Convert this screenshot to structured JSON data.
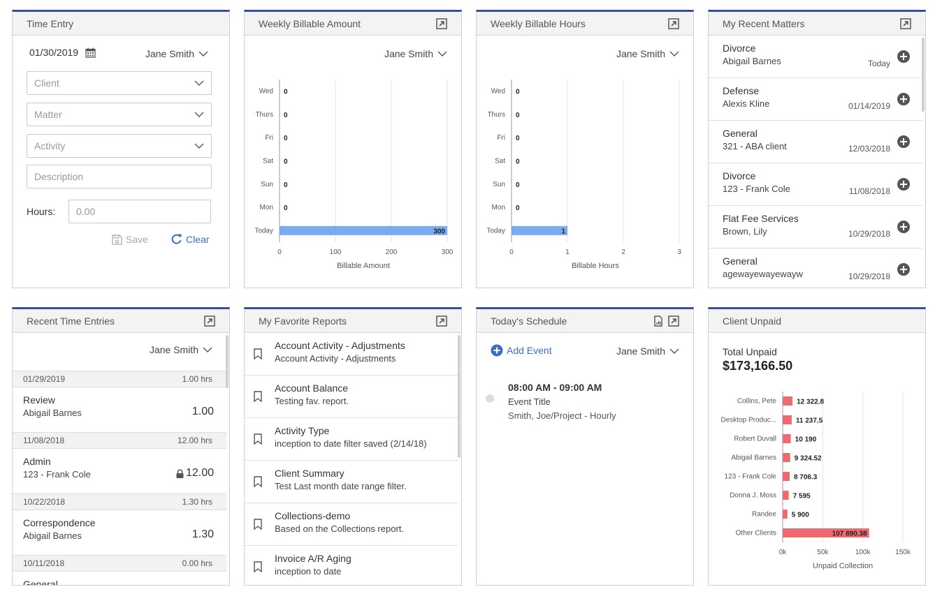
{
  "colors": {
    "accent": "#3a4f9e",
    "link": "#3a6fc7",
    "bar_blue": "#7aaaf0",
    "bar_red": "#ec6b72"
  },
  "time_entry": {
    "title": "Time Entry",
    "date": "01/30/2019",
    "user": "Jane Smith",
    "client_placeholder": "Client",
    "matter_placeholder": "Matter",
    "activity_placeholder": "Activity",
    "description_placeholder": "Description",
    "hours_label": "Hours:",
    "hours_placeholder": "0.00",
    "save_label": "Save",
    "clear_label": "Clear"
  },
  "billable_amount": {
    "title": "Weekly Billable Amount",
    "user": "Jane Smith"
  },
  "billable_hours": {
    "title": "Weekly Billable Hours",
    "user": "Jane Smith"
  },
  "recent_matters": {
    "title": "My Recent Matters",
    "items": [
      {
        "title": "Divorce",
        "sub": "Abigail Barnes",
        "date": "Today"
      },
      {
        "title": "Defense",
        "sub": "Alexis Kline",
        "date": "01/14/2019"
      },
      {
        "title": "General",
        "sub": "321 - ABA client",
        "date": "12/03/2018"
      },
      {
        "title": "Divorce",
        "sub": "123 - Frank Cole",
        "date": "11/08/2018"
      },
      {
        "title": "Flat Fee Services",
        "sub": "Brown, Lily",
        "date": "10/29/2018"
      },
      {
        "title": "General",
        "sub": "agewayewayewayw",
        "date": "10/29/2018"
      }
    ]
  },
  "recent_entries": {
    "title": "Recent Time Entries",
    "user": "Jane Smith",
    "groups": [
      {
        "date": "01/29/2019",
        "total": "1.00 hrs",
        "title": "Review",
        "sub": "Abigail Barnes",
        "hours": "1.00"
      },
      {
        "date": "11/08/2018",
        "total": "12.00 hrs",
        "title": "Admin",
        "sub": "123 - Frank Cole",
        "hours": "12.00"
      },
      {
        "date": "10/22/2018",
        "total": "1.30 hrs",
        "title": "Correspondence",
        "sub": "Abigail Barnes",
        "hours": "1.30"
      },
      {
        "date": "10/11/2018",
        "total": "0.00 hrs",
        "title": "General",
        "sub": "",
        "hours": ""
      }
    ]
  },
  "favorite_reports": {
    "title": "My Favorite Reports",
    "items": [
      {
        "title": "Account Activity - Adjustments",
        "sub": "Account Activity - Adjustments"
      },
      {
        "title": "Account Balance",
        "sub": "Testing fav. report."
      },
      {
        "title": "Activity Type",
        "sub": "inception to date filter saved (2/14/18)"
      },
      {
        "title": "Client Summary",
        "sub": "Test Last month date range filter."
      },
      {
        "title": "Collections-demo",
        "sub": "Based on the Collections report."
      },
      {
        "title": "Invoice A/R Aging",
        "sub": "inception to date"
      }
    ]
  },
  "schedule": {
    "title": "Today's Schedule",
    "add_event_label": "Add Event",
    "user": "Jane Smith",
    "event": {
      "time": "08:00 AM - 09:00 AM",
      "title": "Event Title",
      "sub": "Smith, Joe/Project - Hourly"
    }
  },
  "client_unpaid": {
    "title": "Client Unpaid",
    "total_label": "Total Unpaid",
    "total_value": "$173,166.50"
  },
  "chart_data": [
    {
      "type": "bar",
      "orientation": "horizontal",
      "categories": [
        "Wed",
        "Thurs",
        "Fri",
        "Sat",
        "Sun",
        "Mon",
        "Today"
      ],
      "values": [
        0,
        0,
        0,
        0,
        0,
        0,
        300
      ],
      "data_labels": [
        "0",
        "0",
        "0",
        "0",
        "0",
        "0",
        "300"
      ],
      "xlabel": "Billable Amount",
      "xticks": [
        "0",
        "100",
        "200",
        "300"
      ],
      "xlim": [
        0,
        300
      ],
      "grid": true
    },
    {
      "type": "bar",
      "orientation": "horizontal",
      "categories": [
        "Wed",
        "Thurs",
        "Fri",
        "Sat",
        "Sun",
        "Mon",
        "Today"
      ],
      "values": [
        0,
        0,
        0,
        0,
        0,
        0,
        1
      ],
      "data_labels": [
        "0",
        "0",
        "0",
        "0",
        "0",
        "0",
        "1"
      ],
      "xlabel": "Billable Hours",
      "xticks": [
        "0",
        "1",
        "2",
        "3"
      ],
      "xlim": [
        0,
        3
      ],
      "grid": true
    },
    {
      "type": "bar",
      "orientation": "horizontal",
      "categories": [
        "Collins, Pete",
        "Desktop Produc...",
        "Robert Duvall",
        "Abigail Barnes",
        "123 - Frank Cole",
        "Donna J. Moss",
        "Randee",
        "Other Clients"
      ],
      "values": [
        12322.8,
        11237.5,
        10190,
        9324.52,
        8706.3,
        7595,
        5900,
        107890.38
      ],
      "data_labels": [
        "12 322.8",
        "11 237.5",
        "10 190",
        "9 324.52",
        "8 706.3",
        "7 595",
        "5 900",
        "107 890.38"
      ],
      "xlabel": "Unpaid Collection",
      "xticks": [
        "0k",
        "50k",
        "100k",
        "150k"
      ],
      "xlim": [
        0,
        150000
      ],
      "grid": true
    }
  ]
}
